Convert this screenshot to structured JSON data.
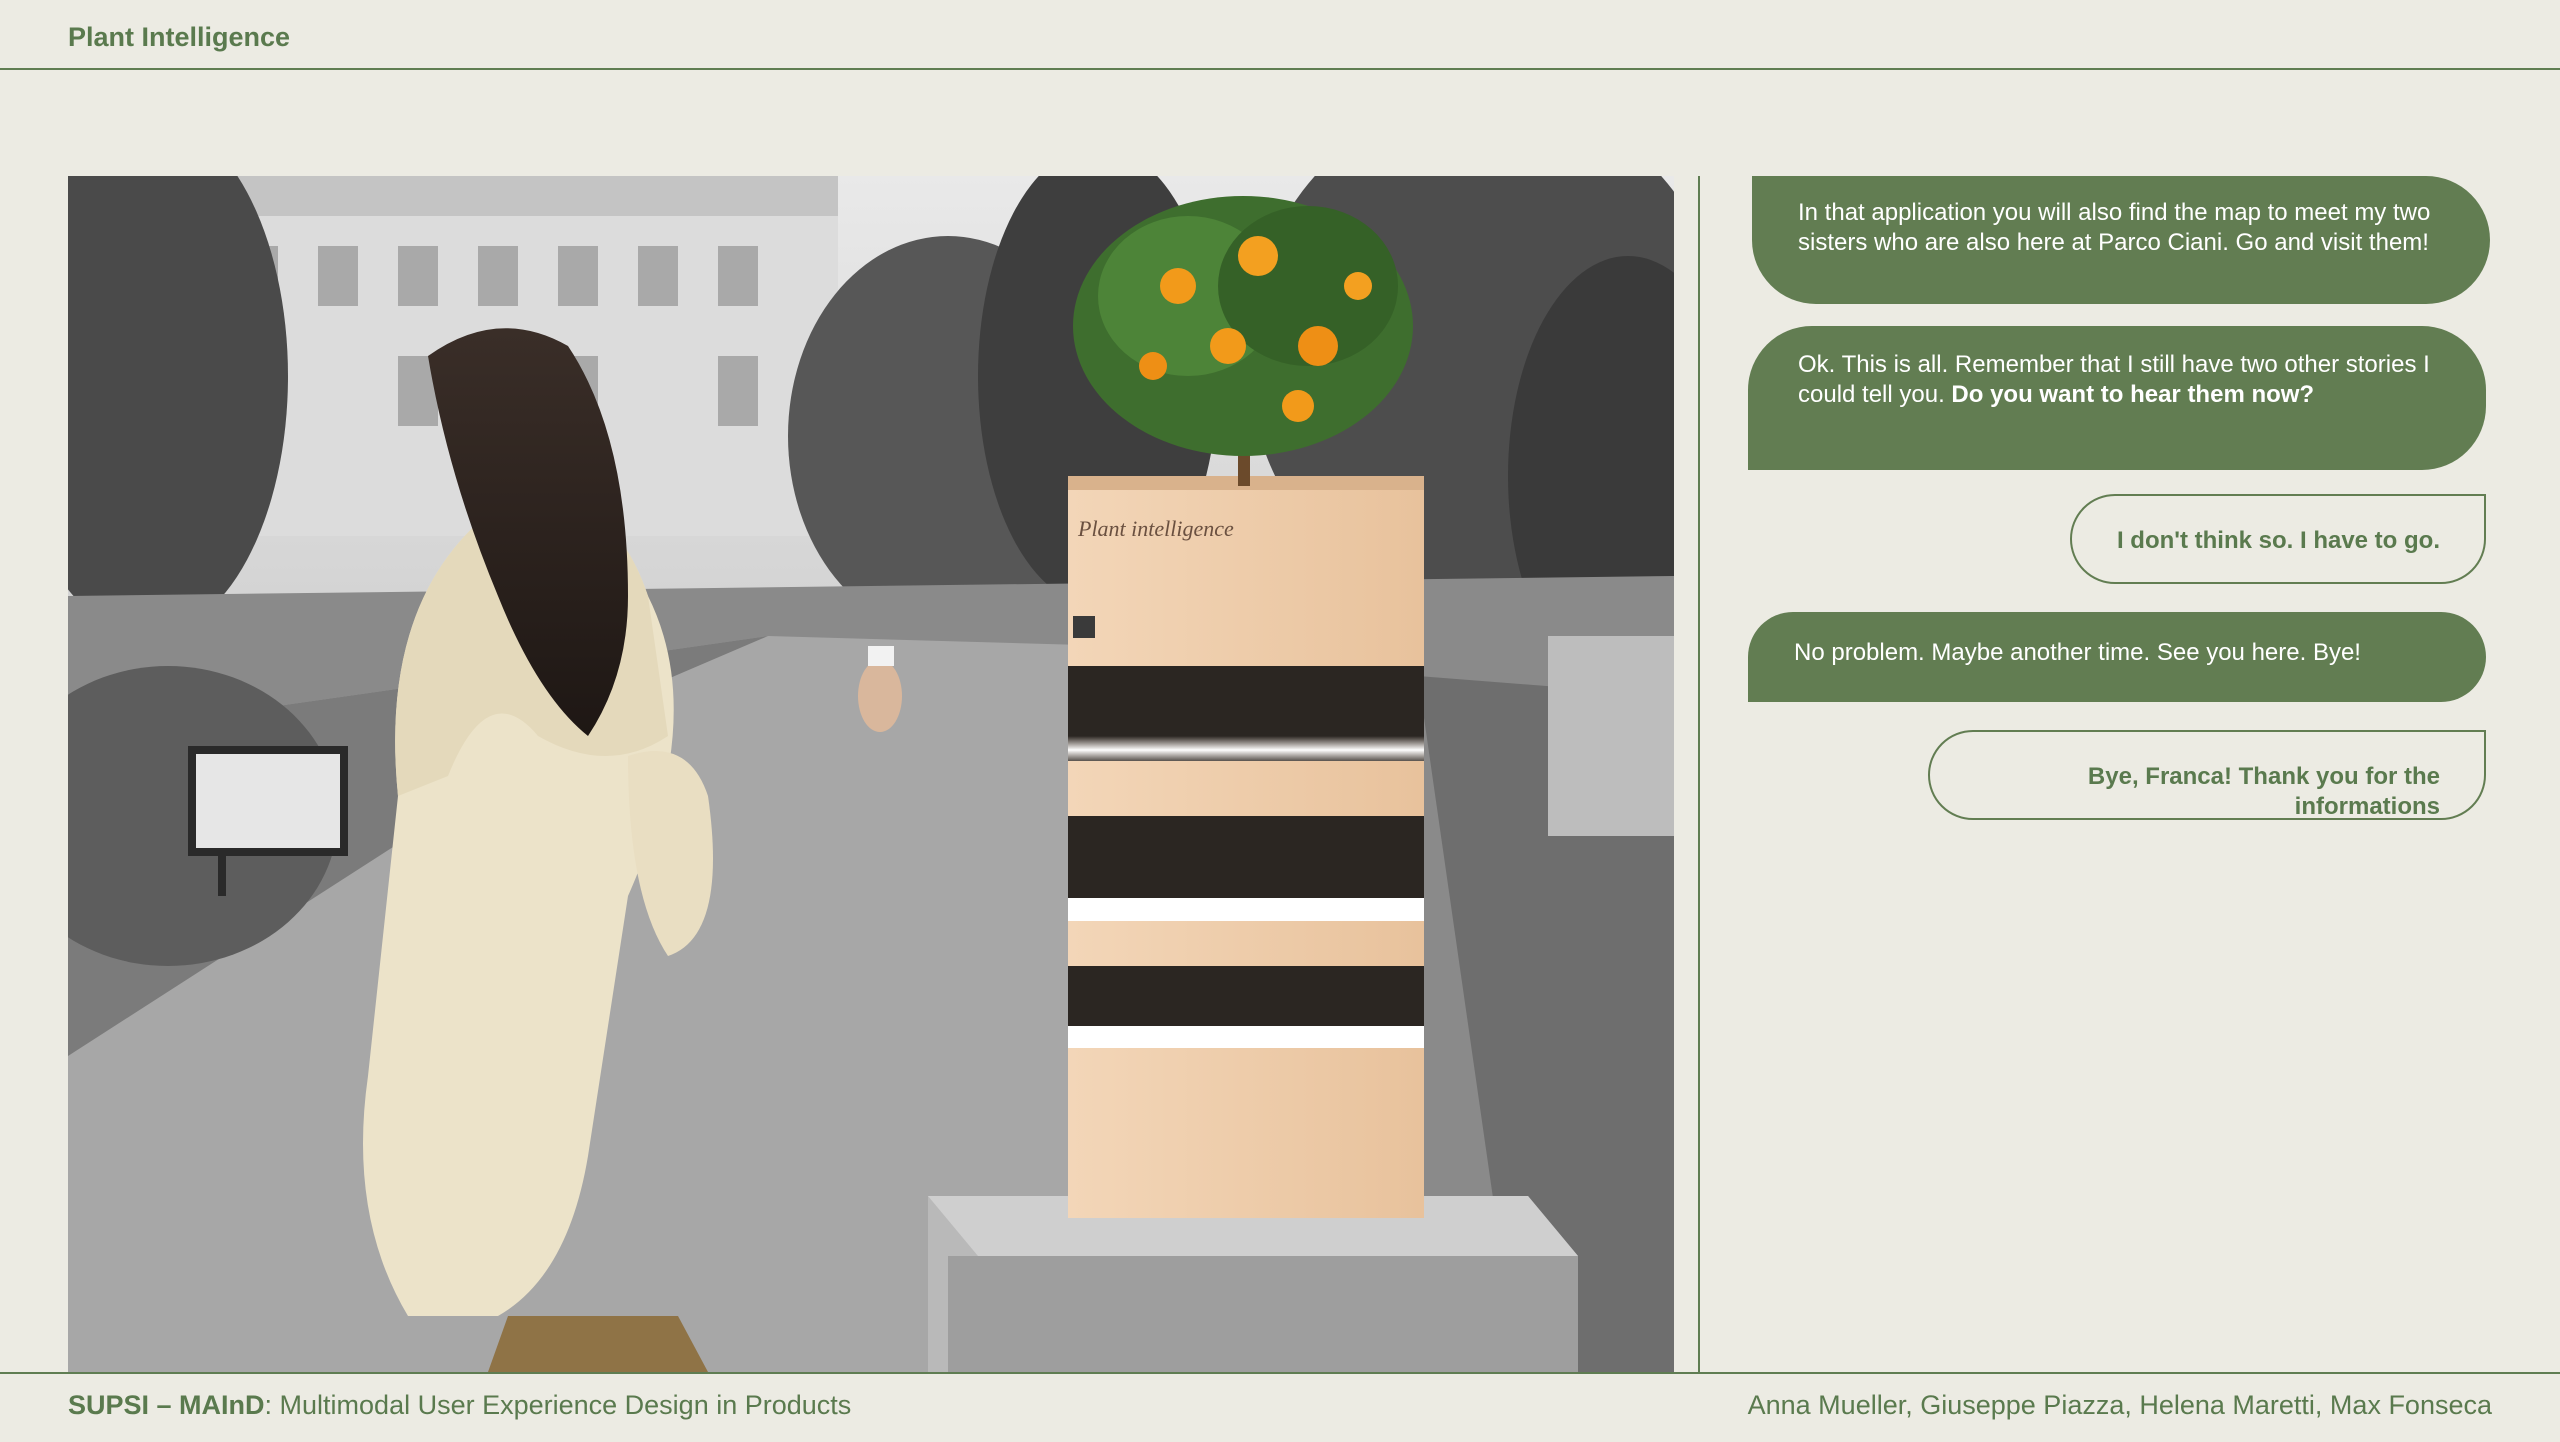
{
  "header": {
    "title": "Plant Intelligence"
  },
  "footer": {
    "left_bold": "SUPSI – MAInD",
    "left_rest": ": Multimodal User Experience Design in Products",
    "authors": "Anna Mueller, Giuseppe Piazza, Helena Maretti, Max Fonseca"
  },
  "chat": {
    "messages": [
      {
        "from": "plant",
        "text": "In that application you will also find the map to meet my two sisters who are also here at Parco Ciani. Go and visit them!"
      },
      {
        "from": "plant",
        "text": "Ok. This is all. Remember that I still have two other stories I could tell you. ",
        "bold": "Do you want to hear them now?"
      },
      {
        "from": "user",
        "text": "I don't think so. I have to go."
      },
      {
        "from": "plant",
        "text": "No problem. Maybe another time. See you here. Bye!"
      },
      {
        "from": "user",
        "text": "Bye, Franca! Thank you for the informations"
      }
    ]
  },
  "colors": {
    "accent": "#627d52",
    "background": "#ecebe3",
    "planter_wood": "#f0cfae"
  },
  "scene": {
    "planter_brand": "Plant intelligence"
  }
}
